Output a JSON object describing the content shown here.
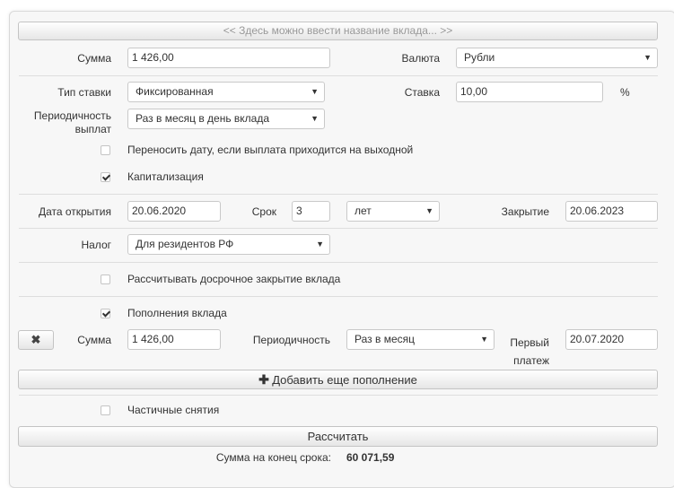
{
  "title_bar": "<< Здесь можно ввести название вклада... >>",
  "sum": {
    "label": "Сумма",
    "value": "1 426,00"
  },
  "currency": {
    "label": "Валюта",
    "value": "Рубли"
  },
  "rate_type": {
    "label": "Тип ставки",
    "value": "Фиксированная"
  },
  "rate": {
    "label": "Ставка",
    "value": "10,00",
    "unit": "%"
  },
  "periodicity": {
    "label_line1": "Периодичность",
    "label_line2": "выплат",
    "value": "Раз в месяц в день вклада"
  },
  "move_date": {
    "label": "Переносить дату, если выплата приходится на выходной",
    "checked": false
  },
  "capitalization": {
    "label": "Капитализация",
    "checked": true
  },
  "open_date": {
    "label": "Дата открытия",
    "value": "20.06.2020"
  },
  "term": {
    "label": "Срок",
    "value": "3",
    "unit_value": "лет"
  },
  "close_date": {
    "label": "Закрытие",
    "value": "20.06.2023"
  },
  "tax": {
    "label": "Налог",
    "value": "Для резидентов РФ"
  },
  "early_close": {
    "label": "Рассчитывать досрочное закрытие вклада",
    "checked": false
  },
  "top_ups": {
    "label": "Пополнения вклада",
    "checked": true,
    "remove_icon": "close-icon",
    "sum_label": "Сумма",
    "sum_value": "1 426,00",
    "period_label": "Периодичность",
    "period_value": "Раз в месяц",
    "first_label_line1": "Первый",
    "first_label_line2": "платеж",
    "first_value": "20.07.2020",
    "add_button": "Добавить еще пополнение"
  },
  "partial_withdraw": {
    "label": "Частичные снятия",
    "checked": false
  },
  "calculate_button": "Рассчитать",
  "result": {
    "end_sum_label": "Сумма на конец срока:",
    "end_sum_value": "60 071,59"
  }
}
